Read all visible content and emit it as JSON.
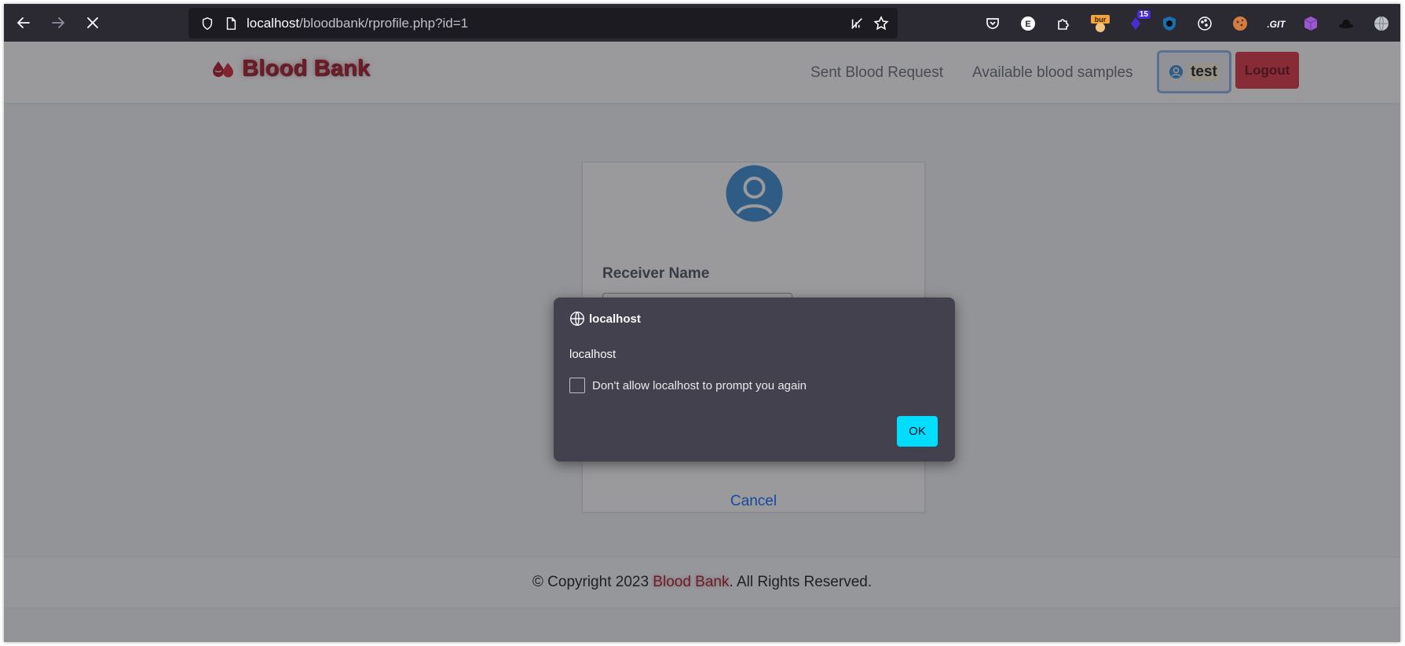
{
  "browser": {
    "url_host": "localhost",
    "url_path": "/bloodbank/rprofile.php?id=1",
    "extensions": [
      "pocket-icon",
      "e-extension-icon",
      "extensions-puzzle-icon",
      "burp-extension-icon",
      "ublock-icon",
      "shield-extension-icon",
      "cookie-icon",
      "cookie-editor-icon",
      "git-extension-icon",
      "cube-extension-icon",
      "hat-extension-icon",
      "globe-extension-icon"
    ],
    "burp_badge": "bur",
    "notification_count": "15"
  },
  "site": {
    "brand": "Blood Bank",
    "nav": {
      "sent_requests": "Sent Blood Request",
      "available_samples": "Available blood samples",
      "user": "test",
      "logout": "Logout"
    },
    "card": {
      "field_label": "Receiver Name",
      "field_value": "",
      "cancel": "Cancel"
    },
    "footer": {
      "prefix": "© Copyright 2023 ",
      "brand": "Blood Bank",
      "suffix": ". All Rights Reserved."
    }
  },
  "dialog": {
    "origin": "localhost",
    "message": "localhost",
    "checkbox_label": "Don't allow localhost to prompt you again",
    "ok": "OK"
  },
  "colors": {
    "brand": "#b01b2e",
    "logout": "#dc3545",
    "link": "#0d6efd",
    "ok_button": "#00ddff",
    "dialog_bg": "#42414d"
  }
}
